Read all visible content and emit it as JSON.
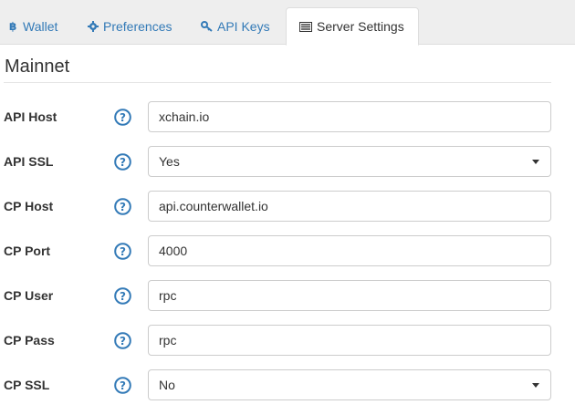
{
  "tabs": [
    {
      "label": "Wallet",
      "icon": "bitcoin-icon"
    },
    {
      "label": "Preferences",
      "icon": "gear-icon"
    },
    {
      "label": "API Keys",
      "icon": "key-icon"
    },
    {
      "label": "Server Settings",
      "icon": "server-icon",
      "active": true
    }
  ],
  "section": {
    "title": "Mainnet"
  },
  "fields": [
    {
      "label": "API Host",
      "type": "text",
      "value": "xchain.io"
    },
    {
      "label": "API SSL",
      "type": "select",
      "value": "Yes"
    },
    {
      "label": "CP Host",
      "type": "text",
      "value": "api.counterwallet.io"
    },
    {
      "label": "CP Port",
      "type": "text",
      "value": "4000"
    },
    {
      "label": "CP User",
      "type": "text",
      "value": "rpc"
    },
    {
      "label": "CP Pass",
      "type": "text",
      "value": "rpc"
    },
    {
      "label": "CP SSL",
      "type": "select",
      "value": "No"
    }
  ],
  "colors": {
    "link": "#337ab7",
    "tabbar_bg": "#eeeeee",
    "border": "#cccccc"
  }
}
